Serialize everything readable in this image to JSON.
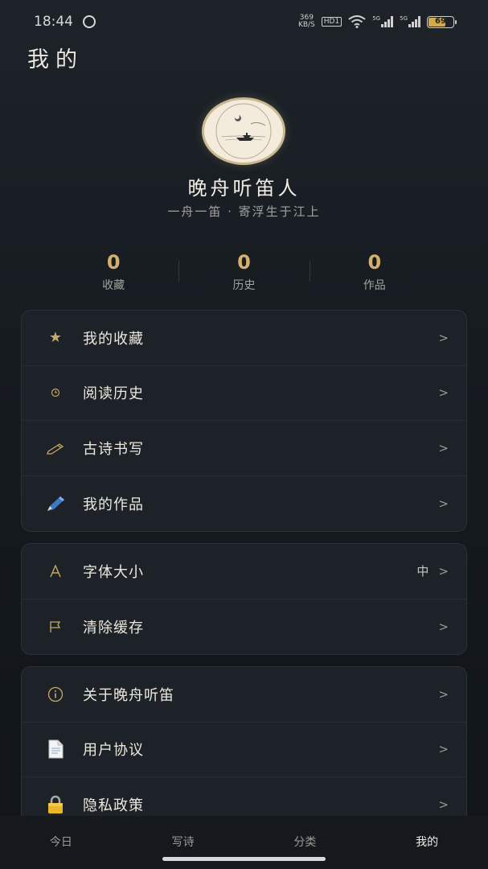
{
  "status_bar": {
    "time": "18:44",
    "speed_value": "369",
    "speed_unit": "KB/S",
    "hd_badge": "HD1",
    "sig1_label": "5G",
    "sig2_label": "5G",
    "battery": "69"
  },
  "header": {
    "title": "我的"
  },
  "profile": {
    "nickname": "晚舟听笛人",
    "signature": "一舟一笛 · 寄浮生于江上"
  },
  "stats": [
    {
      "value": "0",
      "label": "收藏"
    },
    {
      "value": "0",
      "label": "历史"
    },
    {
      "value": "0",
      "label": "作品"
    }
  ],
  "menu_group_1": [
    {
      "icon": "star-icon",
      "label": "我的收藏"
    },
    {
      "icon": "clock-icon",
      "label": "阅读历史"
    },
    {
      "icon": "pencil-icon",
      "label": "古诗书写"
    },
    {
      "icon": "pen-icon",
      "label": "我的作品"
    }
  ],
  "menu_group_2": [
    {
      "icon": "font-icon",
      "label": "字体大小",
      "value": "中"
    },
    {
      "icon": "flag-icon",
      "label": "清除缓存"
    }
  ],
  "menu_group_3": [
    {
      "icon": "info-icon",
      "label": "关于晚舟听笛"
    },
    {
      "icon": "document-icon",
      "label": "用户协议"
    },
    {
      "icon": "lock-icon",
      "label": "隐私政策"
    }
  ],
  "chevron": ">",
  "bottom_nav": [
    {
      "label": "今日"
    },
    {
      "label": "写诗"
    },
    {
      "label": "分类"
    },
    {
      "label": "我的",
      "active": true
    }
  ],
  "colors": {
    "accent": "#d5b06a",
    "background": "#161b20",
    "card": "#1c2227"
  }
}
